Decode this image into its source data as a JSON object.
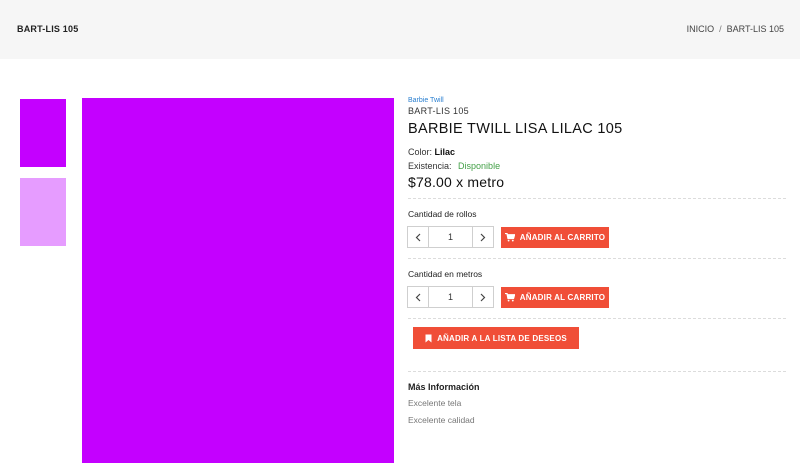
{
  "header": {
    "title": "BART-LIS 105",
    "breadcrumb": {
      "home": "INICIO",
      "separator": "/",
      "current": "BART-LIS 105"
    }
  },
  "gallery": {
    "main_color": "#c400ff",
    "thumbnails": [
      {
        "color": "#c400ff"
      },
      {
        "color": "#e69cff"
      }
    ]
  },
  "product": {
    "category": "Barbie Twill",
    "sku": "BART-LIS 105",
    "title": "BARBIE TWILL LISA LILAC 105",
    "color_label": "Color:",
    "color_value": "Lilac",
    "stock_label": "Existencia:",
    "stock_value": "Disponible",
    "price": "$78.00 x metro"
  },
  "purchase": {
    "rolls": {
      "label": "Cantidad de rollos",
      "quantity": "1",
      "button": "AÑADIR AL CARRITO"
    },
    "meters": {
      "label": "Cantidad en metros",
      "quantity": "1",
      "button": "AÑADIR AL CARRITO"
    },
    "wishlist_button": "AÑADIR A LA LISTA DE DESEOS"
  },
  "more_info": {
    "title": "Más Información",
    "lines": [
      "Excelente tela",
      "Excelente calidad"
    ]
  },
  "colors": {
    "accent": "#f04e37",
    "link": "#2a7fd0",
    "available": "#43a047"
  },
  "icons": {
    "cart": "cart-icon",
    "bookmark": "bookmark-icon",
    "minus": "chevron-left-icon",
    "plus": "chevron-right-icon"
  }
}
